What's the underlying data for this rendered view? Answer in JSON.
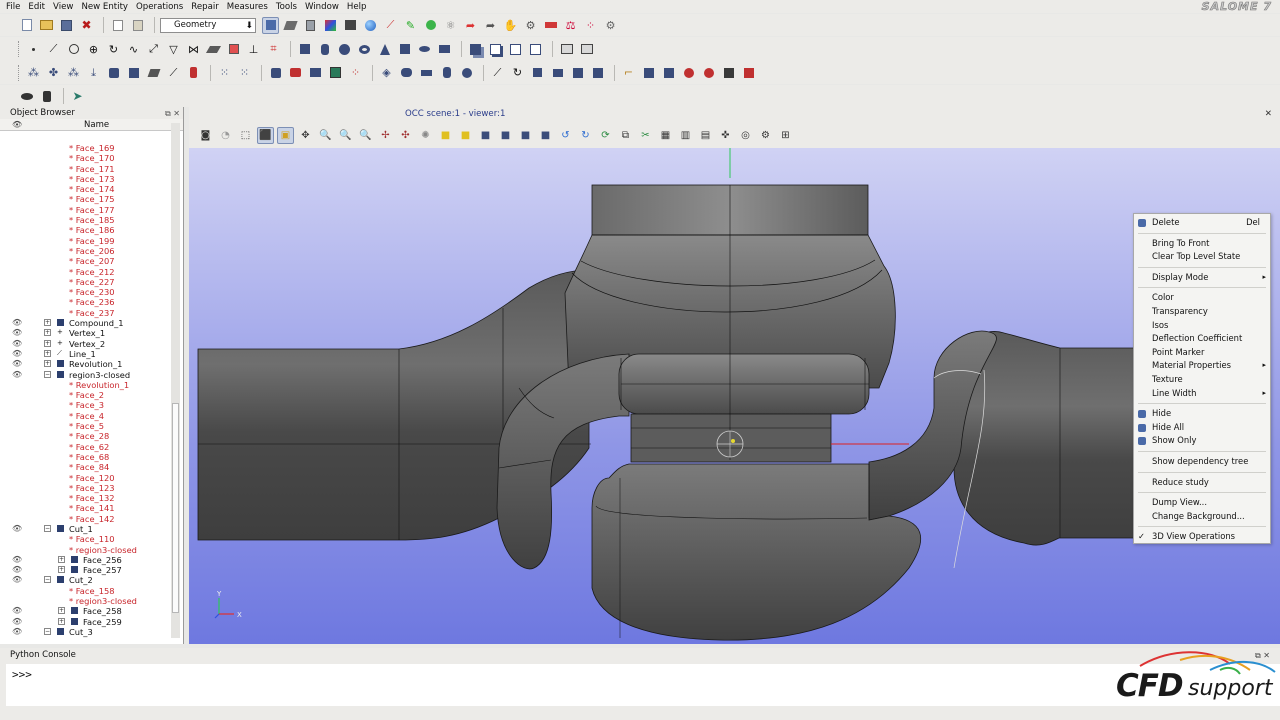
{
  "app": {
    "brand": "SALOME 7"
  },
  "menubar": [
    "File",
    "Edit",
    "View",
    "New Entity",
    "Operations",
    "Repair",
    "Measures",
    "Tools",
    "Window",
    "Help"
  ],
  "toolbar": {
    "module": "Geometry"
  },
  "object_browser": {
    "title": "Object Browser",
    "column_name": "Name",
    "rows": [
      {
        "label": "* Face_169",
        "red": true,
        "indent": 2
      },
      {
        "label": "* Face_170",
        "red": true,
        "indent": 2
      },
      {
        "label": "* Face_171",
        "red": true,
        "indent": 2
      },
      {
        "label": "* Face_173",
        "red": true,
        "indent": 2
      },
      {
        "label": "* Face_174",
        "red": true,
        "indent": 2
      },
      {
        "label": "* Face_175",
        "red": true,
        "indent": 2
      },
      {
        "label": "* Face_177",
        "red": true,
        "indent": 2
      },
      {
        "label": "* Face_185",
        "red": true,
        "indent": 2
      },
      {
        "label": "* Face_186",
        "red": true,
        "indent": 2
      },
      {
        "label": "* Face_199",
        "red": true,
        "indent": 2
      },
      {
        "label": "* Face_206",
        "red": true,
        "indent": 2
      },
      {
        "label": "* Face_207",
        "red": true,
        "indent": 2
      },
      {
        "label": "* Face_212",
        "red": true,
        "indent": 2
      },
      {
        "label": "* Face_227",
        "red": true,
        "indent": 2
      },
      {
        "label": "* Face_230",
        "red": true,
        "indent": 2
      },
      {
        "label": "* Face_236",
        "red": true,
        "indent": 2
      },
      {
        "label": "* Face_237",
        "red": true,
        "indent": 2
      },
      {
        "label": "Compound_1",
        "red": false,
        "indent": 1,
        "eye": true,
        "expander": true,
        "icon": "compound"
      },
      {
        "label": "Vertex_1",
        "red": false,
        "indent": 1,
        "eye": true,
        "expander": true,
        "icon": "vertex"
      },
      {
        "label": "Vertex_2",
        "red": false,
        "indent": 1,
        "eye": true,
        "expander": true,
        "icon": "vertex"
      },
      {
        "label": "Line_1",
        "red": false,
        "indent": 1,
        "eye": true,
        "expander": true,
        "icon": "line"
      },
      {
        "label": "Revolution_1",
        "red": false,
        "indent": 1,
        "eye": true,
        "expander": true,
        "icon": "solid"
      },
      {
        "label": "region3-closed",
        "red": false,
        "indent": 1,
        "eye": true,
        "expander": true,
        "expanded": true,
        "icon": "shell"
      },
      {
        "label": "* Revolution_1",
        "red": true,
        "indent": 2
      },
      {
        "label": "* Face_2",
        "red": true,
        "indent": 2
      },
      {
        "label": "* Face_3",
        "red": true,
        "indent": 2
      },
      {
        "label": "* Face_4",
        "red": true,
        "indent": 2
      },
      {
        "label": "* Face_5",
        "red": true,
        "indent": 2
      },
      {
        "label": "* Face_28",
        "red": true,
        "indent": 2
      },
      {
        "label": "* Face_62",
        "red": true,
        "indent": 2
      },
      {
        "label": "* Face_68",
        "red": true,
        "indent": 2
      },
      {
        "label": "* Face_84",
        "red": true,
        "indent": 2
      },
      {
        "label": "* Face_120",
        "red": true,
        "indent": 2
      },
      {
        "label": "* Face_123",
        "red": true,
        "indent": 2
      },
      {
        "label": "* Face_132",
        "red": true,
        "indent": 2
      },
      {
        "label": "* Face_141",
        "red": true,
        "indent": 2
      },
      {
        "label": "* Face_142",
        "red": true,
        "indent": 2
      },
      {
        "label": "Cut_1",
        "red": false,
        "indent": 1,
        "eye": true,
        "expander": true,
        "expanded": true,
        "icon": "shell"
      },
      {
        "label": "* Face_110",
        "red": true,
        "indent": 2
      },
      {
        "label": "* region3-closed",
        "red": true,
        "indent": 2
      },
      {
        "label": "Face_256",
        "red": false,
        "indent": 2,
        "eye": true,
        "expander": true,
        "icon": "face"
      },
      {
        "label": "Face_257",
        "red": false,
        "indent": 2,
        "eye": true,
        "expander": true,
        "icon": "face"
      },
      {
        "label": "Cut_2",
        "red": false,
        "indent": 1,
        "eye": true,
        "expander": true,
        "expanded": true,
        "icon": "shell"
      },
      {
        "label": "* Face_158",
        "red": true,
        "indent": 2
      },
      {
        "label": "* region3-closed",
        "red": true,
        "indent": 2
      },
      {
        "label": "Face_258",
        "red": false,
        "indent": 2,
        "eye": true,
        "expander": true,
        "icon": "face"
      },
      {
        "label": "Face_259",
        "red": false,
        "indent": 2,
        "eye": true,
        "expander": true,
        "icon": "face"
      },
      {
        "label": "Cut_3",
        "red": false,
        "indent": 1,
        "eye": true,
        "expander": true,
        "expanded": true,
        "icon": "shell"
      }
    ]
  },
  "viewer": {
    "title": "OCC scene:1 - viewer:1",
    "axis_x": "X",
    "axis_y": "Y"
  },
  "context_menu": {
    "items": [
      {
        "label": "Delete",
        "shortcut": "Del",
        "icon": true
      },
      {
        "sep": true
      },
      {
        "label": "Bring To Front"
      },
      {
        "label": "Clear Top Level State"
      },
      {
        "sep": true
      },
      {
        "label": "Display Mode",
        "submenu": true
      },
      {
        "sep": true
      },
      {
        "label": "Color"
      },
      {
        "label": "Transparency"
      },
      {
        "label": "Isos"
      },
      {
        "label": "Deflection Coefficient"
      },
      {
        "label": "Point Marker"
      },
      {
        "label": "Material Properties",
        "submenu": true
      },
      {
        "label": "Texture"
      },
      {
        "label": "Line Width",
        "submenu": true
      },
      {
        "sep": true
      },
      {
        "label": "Hide",
        "icon": true
      },
      {
        "label": "Hide All",
        "icon": true
      },
      {
        "label": "Show Only",
        "icon": true
      },
      {
        "sep": true
      },
      {
        "label": "Show dependency tree"
      },
      {
        "sep": true
      },
      {
        "label": "Reduce study"
      },
      {
        "sep": true
      },
      {
        "label": "Dump View..."
      },
      {
        "label": "Change Background..."
      },
      {
        "sep": true
      },
      {
        "label": "3D View Operations",
        "checked": true
      }
    ]
  },
  "console": {
    "title": "Python Console",
    "prompt": ">>>"
  },
  "watermark": {
    "brand": "CFD",
    "brand_suffix": "support"
  },
  "colors": {
    "background_top": "#d0d2f4",
    "background_bottom": "#6e78e0",
    "tree_red": "#c8262c",
    "viewer_title": "#2a3c8a"
  }
}
